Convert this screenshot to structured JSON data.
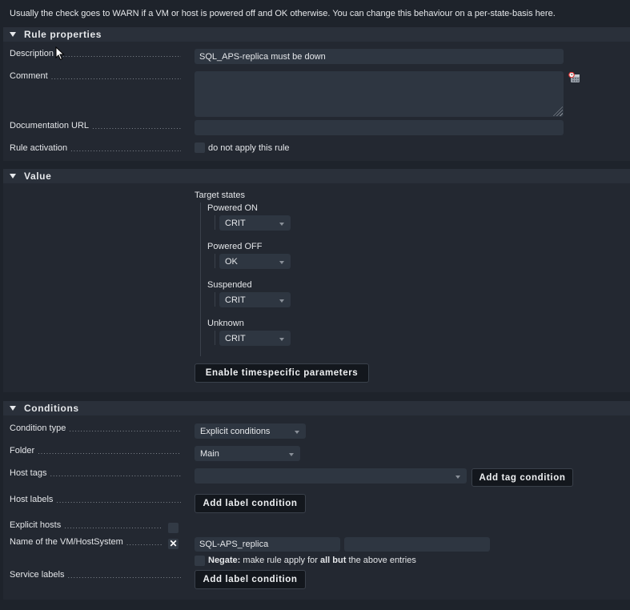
{
  "intro_text": "Usually the check goes to WARN if a VM or host is powered off and OK otherwise. You can change this behaviour on a per-state-basis here.",
  "rule_properties": {
    "title": "Rule properties",
    "description_label": "Description",
    "description_value": "SQL_APS-replica must be down",
    "comment_label": "Comment",
    "comment_value": "",
    "doc_url_label": "Documentation URL",
    "doc_url_value": "",
    "activation_label": "Rule activation",
    "activation_checkbox_label": "do not apply this rule",
    "activation_checked": false
  },
  "value": {
    "title": "Value",
    "target_states_label": "Target states",
    "states": [
      {
        "label": "Powered ON",
        "selected": "CRIT"
      },
      {
        "label": "Powered OFF",
        "selected": "OK"
      },
      {
        "label": "Suspended",
        "selected": "CRIT"
      },
      {
        "label": "Unknown",
        "selected": "CRIT"
      }
    ],
    "timespecific_button": "Enable timespecific parameters"
  },
  "conditions": {
    "title": "Conditions",
    "condition_type_label": "Condition type",
    "condition_type_value": "Explicit conditions",
    "folder_label": "Folder",
    "folder_value": "Main",
    "host_tags_label": "Host tags",
    "host_tags_value": "",
    "add_tag_button": "Add tag condition",
    "host_labels_label": "Host labels",
    "add_host_label_button": "Add label condition",
    "explicit_hosts_label": "Explicit hosts",
    "explicit_hosts_checked": false,
    "vm_name_label": "Name of the VM/HostSystem",
    "vm_name_entries": [
      "SQL-APS_replica",
      ""
    ],
    "negate_bold": "Negate:",
    "negate_text_1": " make rule apply for ",
    "negate_text_bold2": "all but",
    "negate_text_2": " the above entries",
    "service_labels_label": "Service labels",
    "add_service_label_button": "Add label condition"
  }
}
